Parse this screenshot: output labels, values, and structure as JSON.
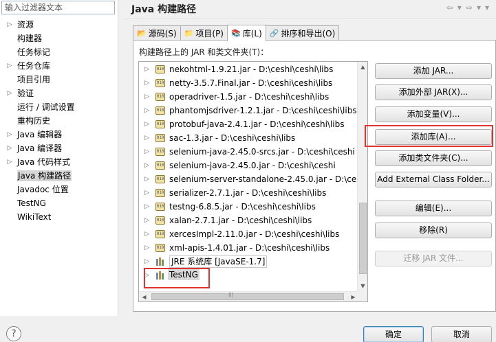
{
  "filter": {
    "placeholder": "输入过滤器文本"
  },
  "nav": {
    "items": [
      {
        "label": "资源",
        "expandable": true
      },
      {
        "label": "构建器",
        "expandable": false
      },
      {
        "label": "任务标记",
        "expandable": false
      },
      {
        "label": "任务仓库",
        "expandable": true
      },
      {
        "label": "项目引用",
        "expandable": false
      },
      {
        "label": "验证",
        "expandable": true
      },
      {
        "label": "运行 / 调试设置",
        "expandable": false
      },
      {
        "label": "重构历史",
        "expandable": false
      },
      {
        "label": "Java 编辑器",
        "expandable": true
      },
      {
        "label": "Java 编译器",
        "expandable": true
      },
      {
        "label": "Java 代码样式",
        "expandable": true
      },
      {
        "label": "Java 构建路径",
        "expandable": false,
        "selected": true
      },
      {
        "label": "Javadoc 位置",
        "expandable": false
      },
      {
        "label": "TestNG",
        "expandable": false
      },
      {
        "label": "WikiText",
        "expandable": false
      }
    ]
  },
  "header": {
    "title": "Java 构建路径"
  },
  "tabs": [
    {
      "label": "源码(S)",
      "icon": "folder-source-icon"
    },
    {
      "label": "项目(P)",
      "icon": "project-icon"
    },
    {
      "label": "库(L)",
      "icon": "library-icon",
      "active": true
    },
    {
      "label": "排序和导出(O)",
      "icon": "order-export-icon"
    }
  ],
  "panel": {
    "label": "构建路径上的 JAR 和类文件夹(T)："
  },
  "tree": {
    "jars": [
      "nekohtml-1.9.21.jar - D:\\ceshi\\ceshi\\libs",
      "netty-3.5.7.Final.jar - D:\\ceshi\\ceshi\\libs",
      "operadriver-1.5.jar - D:\\ceshi\\ceshi\\libs",
      "phantomjsdriver-1.2.1.jar - D:\\ceshi\\ceshi\\libs",
      "protobuf-java-2.4.1.jar - D:\\ceshi\\ceshi\\libs",
      "sac-1.3.jar - D:\\ceshi\\ceshi\\libs",
      "selenium-java-2.45.0-srcs.jar - D:\\ceshi\\ceshi",
      "selenium-java-2.45.0.jar - D:\\ceshi\\ceshi",
      "selenium-server-standalone-2.45.0.jar - D:\\ces",
      "serializer-2.7.1.jar - D:\\ceshi\\ceshi\\libs",
      "testng-6.8.5.jar - D:\\ceshi\\ceshi\\libs",
      "xalan-2.7.1.jar - D:\\ceshi\\ceshi\\libs",
      "xercesImpl-2.11.0.jar - D:\\ceshi\\ceshi\\libs",
      "xml-apis-1.4.01.jar - D:\\ceshi\\ceshi\\libs"
    ],
    "jar_icon_text": "010",
    "jre_library": "JRE 系统库 [JavaSE-1.7]",
    "testng_library": "TestNG"
  },
  "buttons": {
    "add_jar": "添加 JAR...",
    "add_external_jar": "添加外部 JAR(X)...",
    "add_variable": "添加变量(V)...",
    "add_library": "添加库(A)...",
    "add_class_folder": "添加类文件夹(C)...",
    "add_external_class_folder": "Add External Class Folder...",
    "edit": "编辑(E)...",
    "remove": "移除(R)",
    "migrate_jar": "迁移 JAR 文件..."
  },
  "footer": {
    "help": "?",
    "ok": "确定",
    "cancel": "取消"
  },
  "colors": {
    "annotation_red": "#e0322e",
    "selection_gray": "#d6d6d6"
  }
}
